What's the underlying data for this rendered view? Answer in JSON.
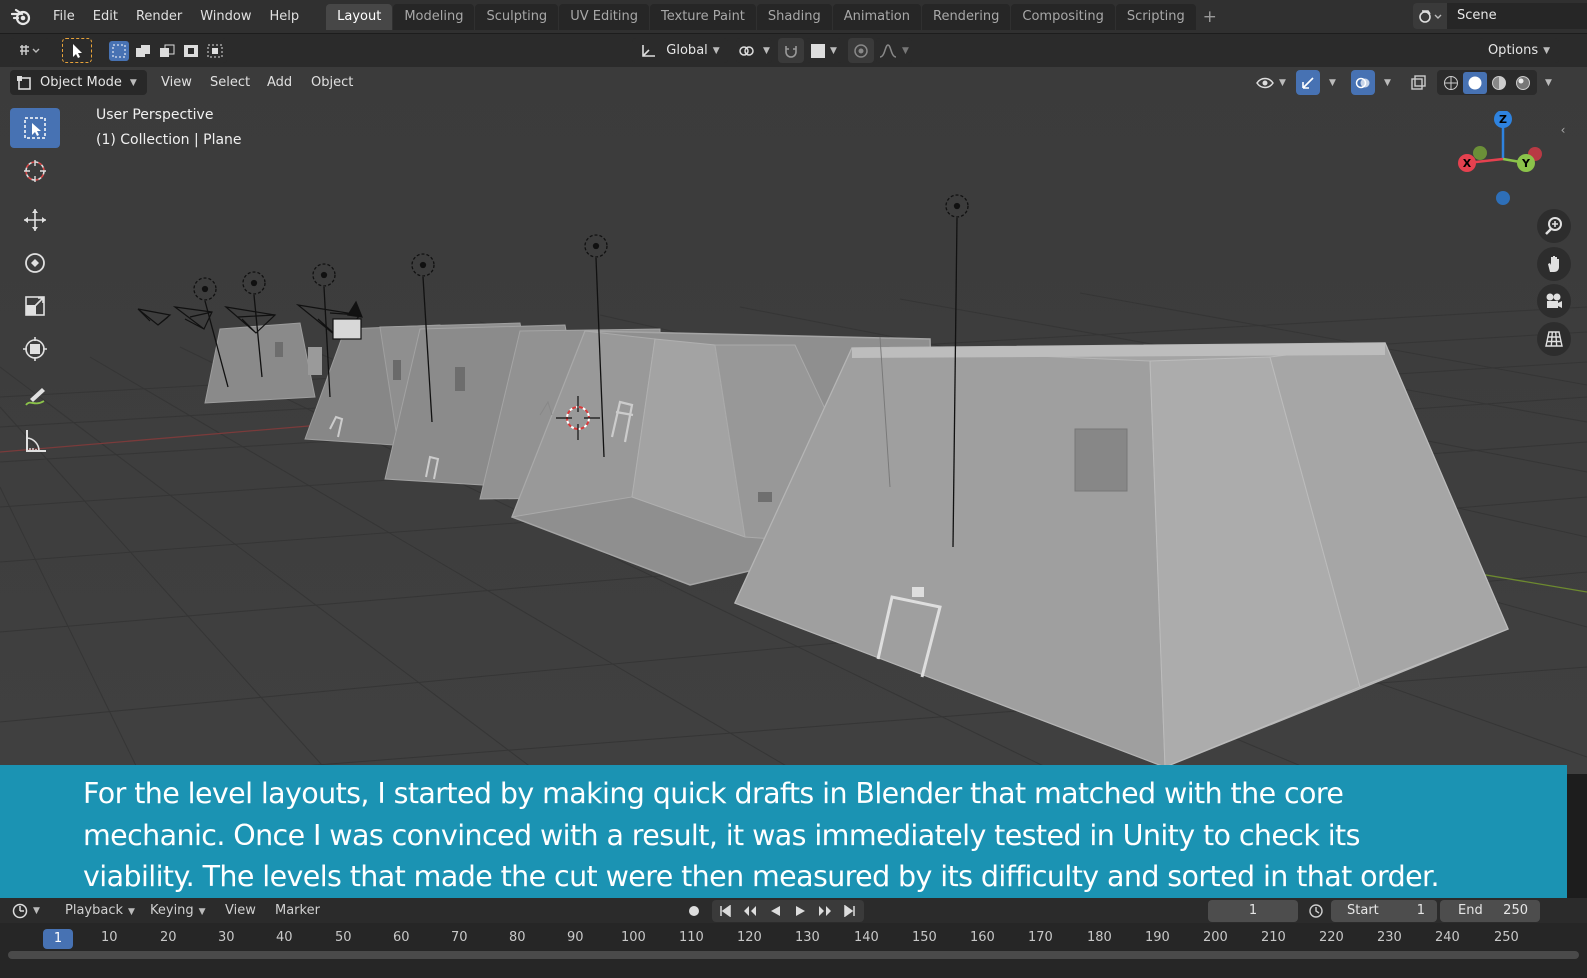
{
  "topbar": {
    "menus": [
      "File",
      "Edit",
      "Render",
      "Window",
      "Help"
    ],
    "workspaces": [
      "Layout",
      "Modeling",
      "Sculpting",
      "UV Editing",
      "Texture Paint",
      "Shading",
      "Animation",
      "Rendering",
      "Compositing",
      "Scripting"
    ],
    "active_workspace": "Layout",
    "add_workspace": "+",
    "scene_name": "Scene"
  },
  "tool_header": {
    "orientation": "Global",
    "options_label": "Options"
  },
  "viewport": {
    "mode": "Object Mode",
    "menus": [
      "View",
      "Select",
      "Add",
      "Object"
    ],
    "info_view": "User Perspective",
    "info_collection": "(1) Collection | Plane",
    "gizmo_axes": {
      "x": "X",
      "y": "Y",
      "z": "Z"
    },
    "colors": {
      "background": "#3d3d3d",
      "x_axis": "#e5414f",
      "y_axis": "#8bc34a",
      "z_axis": "#2e83e0",
      "active_tool": "#4772b3"
    }
  },
  "caption": {
    "lines": [
      "For the level layouts, I started by making quick drafts in Blender that matched with the core",
      "mechanic. Once I was convinced with a result, it was immediately tested in Unity to check its",
      "viability. The levels that made the cut were then measured by its difficulty and sorted in that order."
    ],
    "background": "#1b93b3"
  },
  "timeline": {
    "menus": [
      "Playback",
      "Keying",
      "View",
      "Marker"
    ],
    "current_frame": "1",
    "start_label": "Start",
    "start_value": "1",
    "end_label": "End",
    "end_value": "250",
    "ruler_labels": [
      "1",
      "10",
      "20",
      "30",
      "40",
      "50",
      "60",
      "70",
      "80",
      "90",
      "100",
      "110",
      "120",
      "130",
      "140",
      "150",
      "160",
      "170",
      "180",
      "190",
      "200",
      "210",
      "220",
      "230",
      "240",
      "250"
    ]
  }
}
